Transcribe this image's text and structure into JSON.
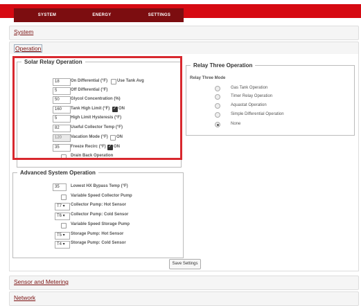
{
  "nav": {
    "tabs": [
      {
        "label": "SYSTEM"
      },
      {
        "label": "ENERGY"
      },
      {
        "label": "SETTINGS"
      }
    ]
  },
  "panels": {
    "system": "System",
    "operation": "Operation",
    "sensor": "Sensor and Metering",
    "network": "Network"
  },
  "solar_relay": {
    "title": "Solar Relay Operation",
    "rows": [
      {
        "value": "18",
        "label": "On Differential (°F)",
        "checkbox_label": "Use Tank Avg"
      },
      {
        "value": "5",
        "label": "Off Differential (°F)"
      },
      {
        "value": "50",
        "label": "Glycol Concentration (%)"
      },
      {
        "value": "160",
        "label": "Tank High Limit (°F)",
        "checkbox_label": "ON"
      },
      {
        "value": "5",
        "label": "High Limit Hysteresis (°F)"
      },
      {
        "value": "82",
        "label": "Useful Collector Temp (°F)"
      },
      {
        "value": "120",
        "label": "Vacation Mode (°F)",
        "checkbox_label": "ON"
      },
      {
        "value": "35",
        "label": "Freeze Recirc (°F)",
        "checkbox_label": "ON"
      }
    ],
    "drain_back": "Drain Back Operation"
  },
  "relay_three": {
    "title": "Relay Three Operation",
    "mode_label": "Relay Three Mode",
    "options": [
      "Gas Tank Operation",
      "Timer Relay Operation",
      "Aquastat Operation",
      "Simple Differential Operation",
      "None"
    ],
    "selected": "None"
  },
  "advanced": {
    "title": "Advanced System Operation",
    "bypass": {
      "value": "35",
      "label": "Lowest HX Bypass Temp (°F)"
    },
    "variable_collector": "Variable Speed Collector Pump",
    "collector_hot": {
      "value": "T7",
      "label": "Collector Pump: Hot Sensor"
    },
    "collector_cold": {
      "value": "T6",
      "label": "Collector Pump: Cold Sensor"
    },
    "variable_storage": "Variable Speed Storage Pump",
    "storage_hot": {
      "value": "T5",
      "label": "Storage Pump: Hot Sensor"
    },
    "storage_cold": {
      "value": "T4",
      "label": "Storage Pump: Cold Sensor"
    }
  },
  "save_button": "Save Settings",
  "colors": {
    "brand_red": "#d60a12",
    "tab_dark": "#7c0d10",
    "highlight": "#d8282e"
  }
}
